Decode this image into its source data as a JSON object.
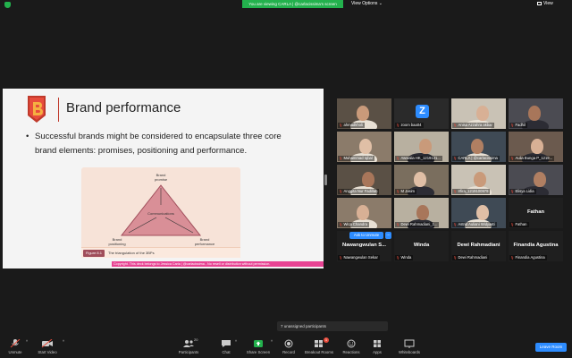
{
  "topbar": {
    "viewing_text": "You are viewing CARLA | @carlacissima's screen",
    "view_options": "View Options",
    "view_mode": "View"
  },
  "slide": {
    "title": "Brand performance",
    "bullet": "Successful brands might be considered to encapsulate three core brand elements: promises, positioning and performance.",
    "figure": {
      "top_label_1": "Brand",
      "top_label_2": "promise",
      "center_label": "Communications",
      "left_label_1": "Brand",
      "left_label_2": "positioning",
      "right_label_1": "Brand",
      "right_label_2": "performance",
      "badge": "Figure 8.1",
      "caption": "The triangulation of the 3BPs"
    },
    "copyright": "Copyright. This deck belongs to Jessica Carla | @carlacissima - No resell or distribution without permission.",
    "colors": {
      "accent": "#c0392b",
      "triangle_fill": "#d98f97",
      "triangle_stroke": "#a04d5a",
      "copyright_bg": "#e84393"
    }
  },
  "gallery": {
    "tiles": [
      {
        "label": "ahmadkholi",
        "muted": true
      },
      {
        "label": "zoom baa04",
        "muted": true,
        "letter": "Z"
      },
      {
        "label": "Anisa Azzahra akbar",
        "muted": true
      },
      {
        "label": "Fadhil",
        "muted": true
      },
      {
        "label": "Muhammad Iqbal",
        "muted": true
      },
      {
        "label": "Awwalia HK_1219121...",
        "muted": true
      },
      {
        "label": "CARLA | @carlacissima",
        "muted": true
      },
      {
        "label": "Aulia Bunga P_1219...",
        "muted": true
      },
      {
        "label": "Anggita Nur Fadillah",
        "muted": true
      },
      {
        "label": "M Jasim",
        "muted": true
      },
      {
        "label": "Irfira_1219100979",
        "muted": true
      },
      {
        "label": "Elisya Lidia",
        "muted": true
      },
      {
        "label": "Wica Chandra",
        "muted": true
      },
      {
        "label": "Dewi Rahmadiani_1...",
        "muted": true
      },
      {
        "label": "Astrid Auliani Widyasti",
        "muted": true
      },
      {
        "label": "Fathan",
        "muted": true,
        "big": "Fathan"
      },
      {
        "label": "Nawangwulan Sekar",
        "muted": true,
        "big": "Nawangwulan S..."
      },
      {
        "label": "Winda",
        "muted": true,
        "big": "Winda"
      },
      {
        "label": "Dewi Rahmadiani",
        "muted": true,
        "big": "Dewi Rahmadiani"
      },
      {
        "label": "Finandia Agustina",
        "muted": true,
        "big": "Finandia Agustina"
      }
    ],
    "ask_unmute": "Ask to Unmute",
    "more": "..."
  },
  "unassigned": "7 unassigned participants",
  "toolbar": {
    "unmute": "Unmute",
    "start_video": "Start Video",
    "participants": "Participants",
    "participants_count": "20",
    "chat": "Chat",
    "share_screen": "Share Screen",
    "record": "Record",
    "breakout_rooms": "Breakout Rooms",
    "breakout_badge": "1",
    "reactions": "Reactions",
    "apps": "Apps",
    "whiteboards": "Whiteboards",
    "leave": "Leave Room"
  }
}
